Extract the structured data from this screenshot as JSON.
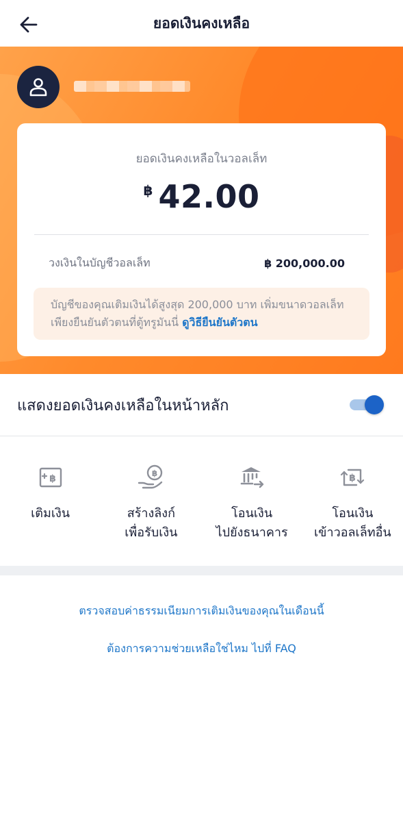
{
  "header": {
    "title": "ยอดเงินคงเหลือ",
    "back_icon": "arrow-left-icon"
  },
  "profile": {
    "avatar_icon": "user-icon"
  },
  "balance": {
    "label": "ยอดเงินคงเหลือในวอลเล็ท",
    "currency_symbol": "฿",
    "amount": "42.00",
    "limit_label": "วงเงินในบัญชีวอลเล็ท",
    "limit_value": "฿ 200,000.00",
    "info_text": "บัญชีของคุณเติมเงินได้สูงสุด 200,000 บาท เพิ่มขนาดวอลเล็ท เพียงยืนยันตัวตนที่ตู้ทรูมันนี่ ",
    "info_link": "ดูวิธียืนยันตัวตน"
  },
  "toggle": {
    "label": "แสดงยอดเงินคงเหลือในหน้าหลัก",
    "enabled": true
  },
  "actions": [
    {
      "line1": "เติมเงิน",
      "line2": "",
      "icon": "topup-icon"
    },
    {
      "line1": "สร้างลิงก์",
      "line2": "เพื่อรับเงิน",
      "icon": "receive-money-icon"
    },
    {
      "line1": "โอนเงิน",
      "line2": "ไปยังธนาคาร",
      "icon": "bank-transfer-icon"
    },
    {
      "line1": "โอนเงิน",
      "line2": "เข้าวอลเล็ทอื่น",
      "icon": "wallet-transfer-icon"
    }
  ],
  "links": {
    "fee_check": "ตรวจสอบค่าธรรมเนียมการเติมเงินของคุณในเดือนนี้",
    "faq": "ต้องการความช่วยเหลือใช่ไหม ไปที่ FAQ"
  },
  "colors": {
    "brand_orange": "#ff8a2b",
    "link_blue": "#1f77c9",
    "toggle_blue": "#1c63c7",
    "navy": "#1b2440"
  }
}
